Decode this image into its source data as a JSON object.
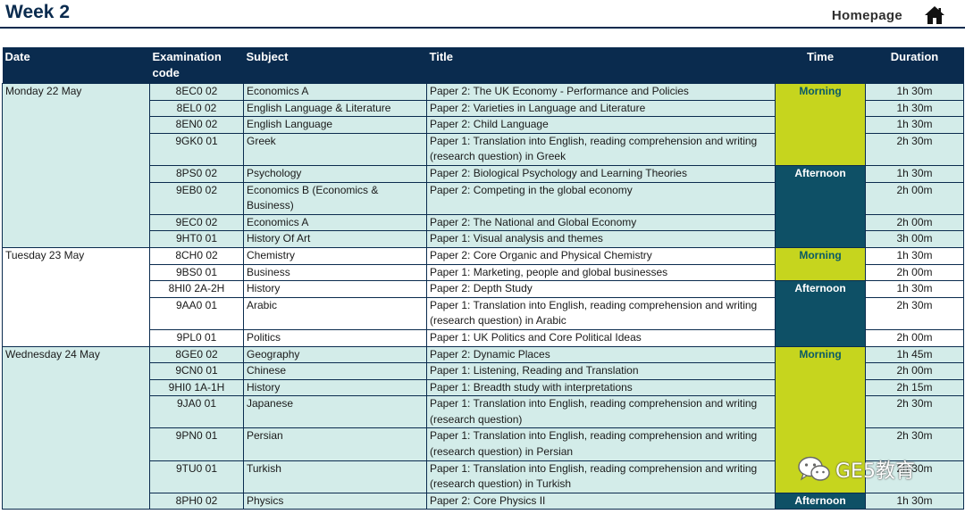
{
  "header": {
    "title": "Week 2",
    "homepage_label": "Homepage"
  },
  "columns": {
    "date": "Date",
    "code": "Examination code",
    "subject": "Subject",
    "title": "Title",
    "time": "Time",
    "duration": "Duration"
  },
  "days": [
    {
      "date": "Monday 22 May",
      "shade": true,
      "slots": [
        {
          "label": "Morning",
          "kind": "morning",
          "rows": [
            {
              "code": "8EC0 02",
              "subject": "Economics A",
              "title": "Paper 2: The UK Economy - Performance and Policies",
              "duration": "1h 30m"
            },
            {
              "code": "8EL0 02",
              "subject": "English Language & Literature",
              "title": "Paper 2: Varieties in Language and Literature",
              "duration": "1h 30m"
            },
            {
              "code": "8EN0 02",
              "subject": "English Language",
              "title": "Paper 2: Child Language",
              "duration": "1h 30m"
            },
            {
              "code": "9GK0 01",
              "subject": "Greek",
              "title": "Paper 1: Translation into English, reading comprehension and writing (research question) in Greek",
              "duration": "2h 30m"
            }
          ]
        },
        {
          "label": "Afternoon",
          "kind": "afternoon",
          "rows": [
            {
              "code": "8PS0 02",
              "subject": "Psychology",
              "title": "Paper 2: Biological Psychology and Learning Theories",
              "duration": "1h 30m"
            },
            {
              "code": "9EB0 02",
              "subject": "Economics B (Economics & Business)",
              "title": "Paper 2: Competing in the global economy",
              "duration": "2h 00m"
            },
            {
              "code": "9EC0 02",
              "subject": "Economics A",
              "title": "Paper 2: The National and Global Economy",
              "duration": "2h 00m"
            },
            {
              "code": "9HT0 01",
              "subject": "History Of Art",
              "title": "Paper 1: Visual analysis and themes",
              "duration": "3h 00m"
            }
          ]
        }
      ]
    },
    {
      "date": "Tuesday 23 May",
      "shade": false,
      "slots": [
        {
          "label": "Morning",
          "kind": "morning",
          "rows": [
            {
              "code": "8CH0 02",
              "subject": "Chemistry",
              "title": "Paper 2: Core Organic and Physical Chemistry",
              "duration": "1h 30m"
            },
            {
              "code": "9BS0 01",
              "subject": "Business",
              "title": "Paper 1: Marketing, people and global businesses",
              "duration": "2h 00m"
            }
          ]
        },
        {
          "label": "Afternoon",
          "kind": "afternoon",
          "rows": [
            {
              "code": "8HI0 2A-2H",
              "subject": "History",
              "title": "Paper 2: Depth Study",
              "duration": "1h  30m"
            },
            {
              "code": "9AA0 01",
              "subject": "Arabic",
              "title": "Paper 1: Translation into English, reading comprehension and writing (research question) in Arabic",
              "duration": "2h 30m"
            },
            {
              "code": "9PL0 01",
              "subject": "Politics",
              "title": "Paper 1: UK Politics and Core Political Ideas",
              "duration": "2h 00m"
            }
          ]
        }
      ]
    },
    {
      "date": "Wednesday 24 May",
      "shade": true,
      "slots": [
        {
          "label": "Morning",
          "kind": "morning",
          "rows": [
            {
              "code": "8GE0 02",
              "subject": "Geography",
              "title": "Paper 2: Dynamic Places",
              "duration": "1h 45m"
            },
            {
              "code": "9CN0 01",
              "subject": "Chinese",
              "title": "Paper 1: Listening, Reading and Translation",
              "duration": "2h 00m"
            },
            {
              "code": "9HI0 1A-1H",
              "subject": "History",
              "title": "Paper 1: Breadth study with interpretations",
              "duration": "2h 15m"
            },
            {
              "code": "9JA0 01",
              "subject": "Japanese",
              "title": "Paper 1: Translation into English, reading comprehension and writing (research question)",
              "duration": "2h 30m"
            },
            {
              "code": "9PN0 01",
              "subject": "Persian",
              "title": "Paper 1: Translation into English, reading comprehension and writing (research question) in Persian",
              "duration": "2h 30m"
            },
            {
              "code": "9TU0 01",
              "subject": "Turkish",
              "title": "Paper 1: Translation into English, reading comprehension and writing (research question) in Turkish",
              "duration": "2h 30m"
            }
          ]
        },
        {
          "label": "Afternoon",
          "kind": "afternoon",
          "rows": [
            {
              "code": "8PH0 02",
              "subject": "Physics",
              "title": "Paper 2: Core Physics II",
              "duration": "1h 30m"
            }
          ]
        }
      ]
    }
  ],
  "watermark": {
    "text": "GE5教育",
    "icon": "wechat-icon"
  },
  "colors": {
    "navy": "#0a2b4e",
    "shade": "#d3ece9",
    "morning": "#c6d51e",
    "afternoon": "#0e5066"
  }
}
